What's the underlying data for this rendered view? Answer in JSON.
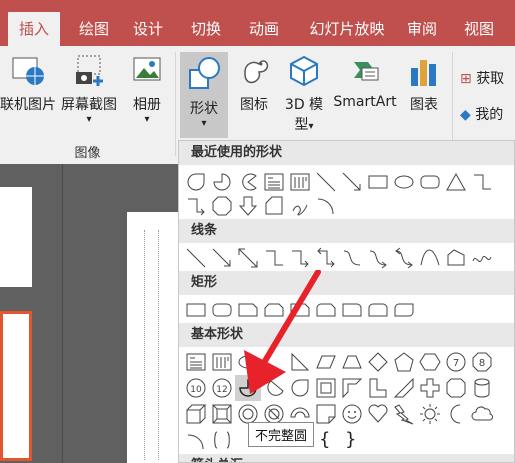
{
  "tabs": [
    {
      "label": "插入",
      "active": true
    },
    {
      "label": "绘图"
    },
    {
      "label": "设计"
    },
    {
      "label": "切换"
    },
    {
      "label": "动画"
    },
    {
      "label": "幻灯片放映"
    },
    {
      "label": "审阅"
    },
    {
      "label": "视图"
    }
  ],
  "ribbon": {
    "online_pictures": "联机图片",
    "screenshot": "屏幕截图",
    "album": "相册",
    "shapes": "形状",
    "icons": "图标",
    "model_3d_line1": "3D 模",
    "model_3d_line2": "型",
    "smartart": "SmartArt",
    "chart": "图表",
    "get_addins": "获取",
    "my_addins": "我的",
    "group_images": "图像",
    "dropdown_glyph": "▾"
  },
  "menu": {
    "recent": "最近使用的形状",
    "lines": "线条",
    "rectangles": "矩形",
    "basic": "基本形状",
    "arrows_partial": "箭头总汇",
    "bracket_left": "{",
    "bracket_right": "}",
    "shape_num_7": "7",
    "shape_num_8": "8",
    "shape_num_10": "10",
    "shape_num_12": "12"
  },
  "tooltip": "不完整圆",
  "colors": {
    "accent": "#c0504d",
    "arrow": "#e8222a"
  }
}
